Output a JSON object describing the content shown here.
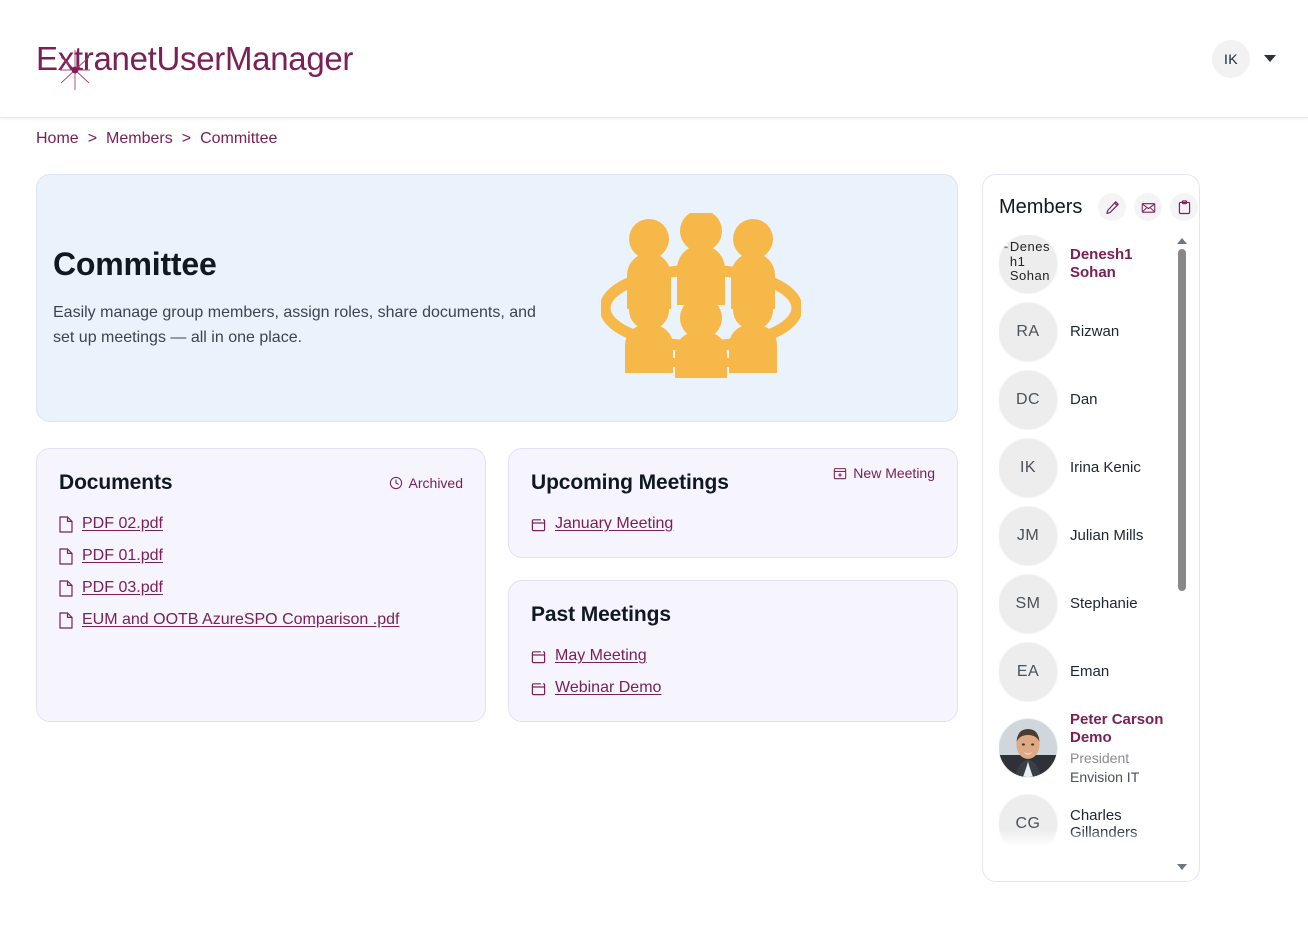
{
  "header": {
    "logo_text": "ExtranetUserManager",
    "logo_accent_color": "#7b2057",
    "user_initials": "IK"
  },
  "breadcrumb": {
    "items": [
      {
        "label": "Home"
      },
      {
        "label": "Members"
      },
      {
        "label": "Committee"
      }
    ],
    "separator": ">"
  },
  "hero": {
    "title": "Committee",
    "subtitle": "Easily manage group members, assign roles, share documents, and set up meetings — all in one place.",
    "illustration": "committee-people-table-icon",
    "illustration_color": "#f6b848",
    "background_color": "#eaf2fb"
  },
  "documents": {
    "title": "Documents",
    "action_label": "Archived",
    "action_icon": "clock-icon",
    "files": [
      {
        "name": "PDF 02.pdf",
        "icon": "file-icon"
      },
      {
        "name": "PDF 01.pdf",
        "icon": "file-icon"
      },
      {
        "name": "PDF 03.pdf",
        "icon": "file-icon"
      },
      {
        "name": "EUM and OOTB AzureSPO Comparison .pdf",
        "icon": "file-icon"
      }
    ]
  },
  "upcoming_meetings": {
    "title": "Upcoming Meetings",
    "action_label": "New Meeting",
    "action_icon": "calendar-plus-icon",
    "items": [
      {
        "name": "January Meeting",
        "icon": "calendar-icon"
      }
    ]
  },
  "past_meetings": {
    "title": "Past Meetings",
    "items": [
      {
        "name": "May Meeting",
        "icon": "calendar-icon"
      },
      {
        "name": "Webinar Demo",
        "icon": "calendar-icon"
      }
    ]
  },
  "members": {
    "title": "Members",
    "actions": [
      {
        "icon": "pencil-icon",
        "name": "edit-members-button"
      },
      {
        "icon": "envelope-icon",
        "name": "email-members-button"
      },
      {
        "icon": "clipboard-icon",
        "name": "clipboard-button"
      }
    ],
    "list": [
      {
        "initials": "",
        "alt_text": "Denesh1 Sohan",
        "name": "Denesh1 Sohan",
        "highlight": true,
        "avatar_type": "broken-image"
      },
      {
        "initials": "RA",
        "name": "Rizwan",
        "highlight": false,
        "avatar_type": "initials"
      },
      {
        "initials": "DC",
        "name": "Dan",
        "highlight": false,
        "avatar_type": "initials"
      },
      {
        "initials": "IK",
        "name": "Irina Kenic",
        "highlight": false,
        "avatar_type": "initials"
      },
      {
        "initials": "JM",
        "name": "Julian Mills",
        "highlight": false,
        "avatar_type": "initials"
      },
      {
        "initials": "SM",
        "name": "Stephanie",
        "highlight": false,
        "avatar_type": "initials"
      },
      {
        "initials": "EA",
        "name": "Eman",
        "highlight": false,
        "avatar_type": "initials"
      },
      {
        "initials": "",
        "name": "Peter Carson Demo",
        "role": "President",
        "org": "Envision IT",
        "highlight": true,
        "avatar_type": "photo"
      },
      {
        "initials": "CG",
        "name": "Charles Gillanders",
        "highlight": false,
        "avatar_type": "initials"
      }
    ]
  }
}
